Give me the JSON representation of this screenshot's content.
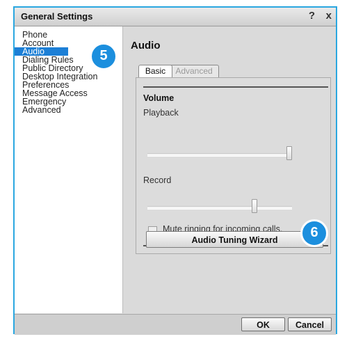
{
  "window": {
    "title": "General Settings",
    "help_glyph": "?",
    "close_glyph": "x"
  },
  "sidebar": {
    "items": [
      {
        "label": "Phone"
      },
      {
        "label": "Account"
      },
      {
        "label": "Audio"
      },
      {
        "label": "Dialing Rules"
      },
      {
        "label": "Public Directory"
      },
      {
        "label": "Desktop Integration"
      },
      {
        "label": "Preferences"
      },
      {
        "label": "Message Access"
      },
      {
        "label": "Emergency"
      },
      {
        "label": "Advanced"
      }
    ],
    "selected": "Audio"
  },
  "callouts": {
    "step_audio": "5",
    "step_wizard": "6",
    "color": "#1c8fde"
  },
  "main": {
    "title": "Audio",
    "tabs": [
      {
        "label": "Basic",
        "active": true
      },
      {
        "label": "Advanced",
        "active": false
      }
    ],
    "volume": {
      "title": "Volume",
      "playback_label": "Playback",
      "playback_level": 1.0,
      "record_label": "Record",
      "record_level": 0.75
    },
    "mute_label": "Mute ringing for incoming calls.",
    "mute_checked": false,
    "wizard_button": "Audio Tuning Wizard"
  },
  "footer": {
    "ok_label": "OK",
    "cancel_label": "Cancel"
  },
  "colors": {
    "accent": "#2aa7e0",
    "selection": "#1c7fd6"
  }
}
